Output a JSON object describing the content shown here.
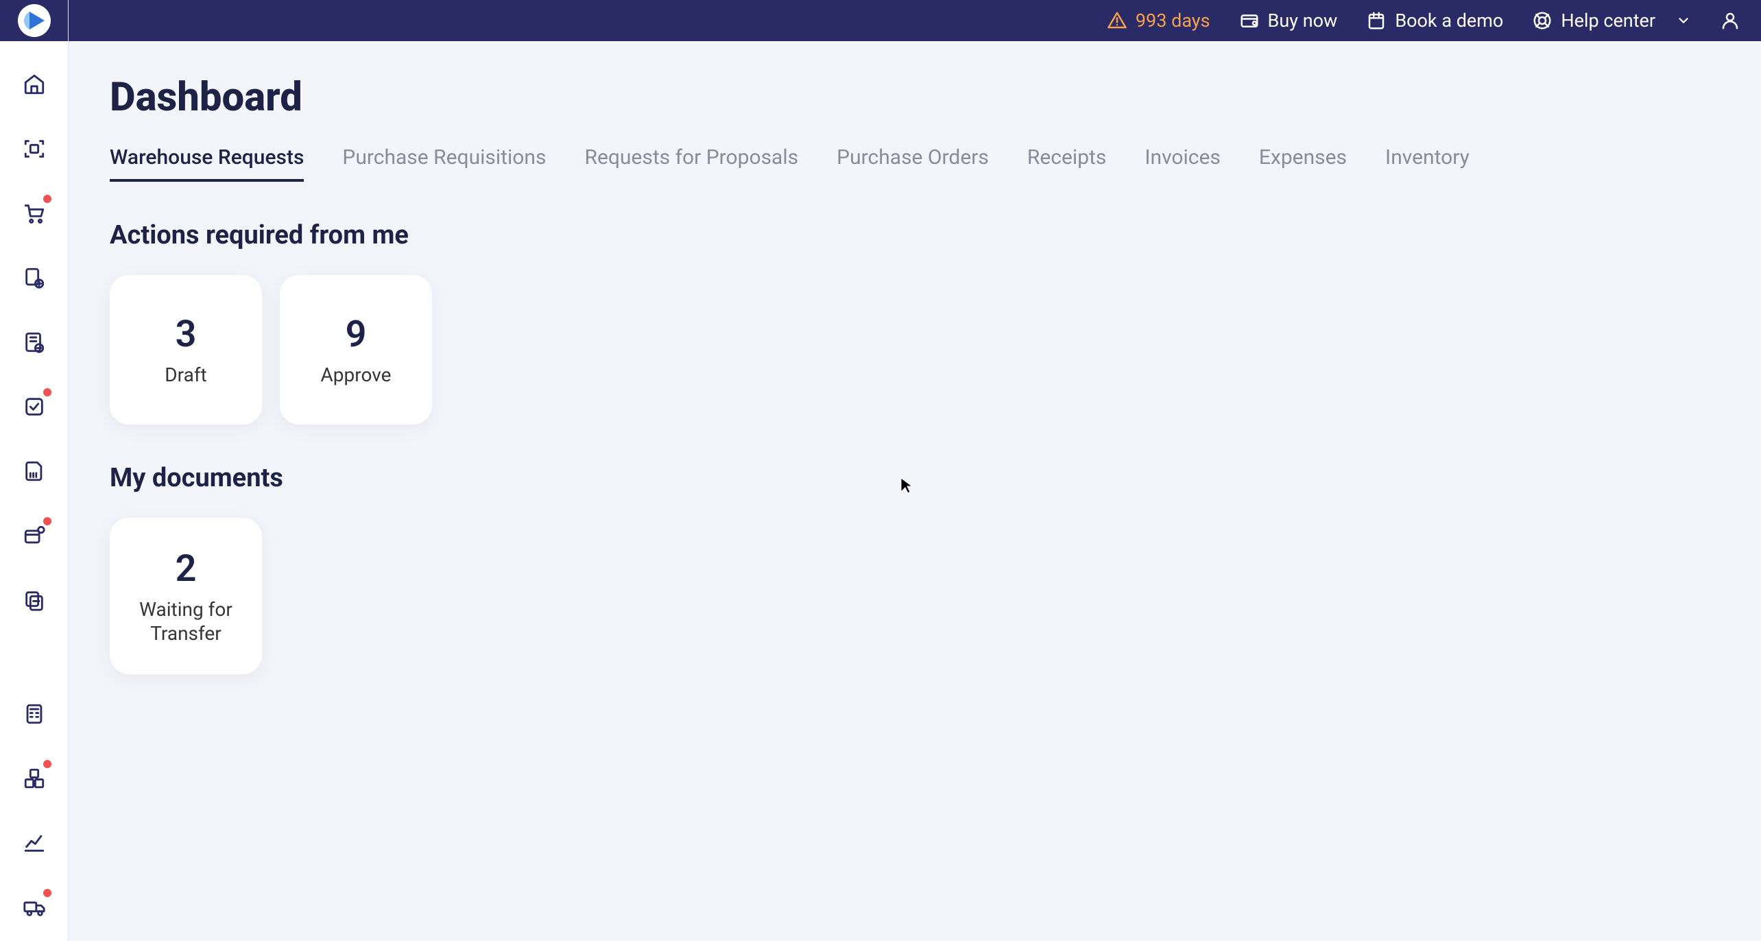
{
  "header": {
    "trial_days": "993 days",
    "buy_now": "Buy now",
    "book_demo": "Book a demo",
    "help_center": "Help center"
  },
  "page": {
    "title": "Dashboard"
  },
  "tabs": [
    {
      "label": "Warehouse Requests",
      "active": true
    },
    {
      "label": "Purchase Requisitions",
      "active": false
    },
    {
      "label": "Requests for Proposals",
      "active": false
    },
    {
      "label": "Purchase Orders",
      "active": false
    },
    {
      "label": "Receipts",
      "active": false
    },
    {
      "label": "Invoices",
      "active": false
    },
    {
      "label": "Expenses",
      "active": false
    },
    {
      "label": "Inventory",
      "active": false
    }
  ],
  "sections": {
    "actions_title": "Actions required from me",
    "documents_title": "My documents"
  },
  "action_cards": [
    {
      "count": "3",
      "label": "Draft"
    },
    {
      "count": "9",
      "label": "Approve"
    }
  ],
  "document_cards": [
    {
      "count": "2",
      "label": "Waiting for Transfer"
    }
  ],
  "sidebar": {
    "items": [
      {
        "name": "home-icon",
        "dot": false
      },
      {
        "name": "scan-icon",
        "dot": false
      },
      {
        "name": "cart-icon",
        "dot": true
      },
      {
        "name": "doc-money-icon",
        "dot": false
      },
      {
        "name": "barcode-doc-icon",
        "dot": false
      },
      {
        "name": "check-box-icon",
        "dot": true
      },
      {
        "name": "file-barcode-icon",
        "dot": false
      },
      {
        "name": "package-doc-icon",
        "dot": true
      },
      {
        "name": "receipt-stack-icon",
        "dot": false
      },
      {
        "name": "calc-icon",
        "dot": false,
        "spacer_before": true
      },
      {
        "name": "boxes-icon",
        "dot": true
      },
      {
        "name": "chart-line-icon",
        "dot": false
      },
      {
        "name": "truck-icon",
        "dot": true
      }
    ]
  }
}
